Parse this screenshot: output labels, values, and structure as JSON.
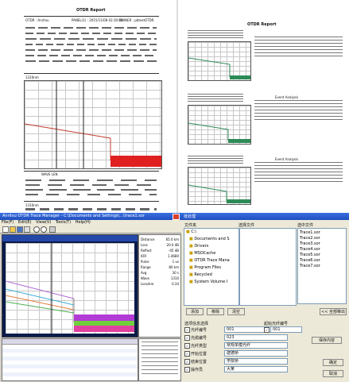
{
  "report": {
    "title": "OTDR Report",
    "q1_meta": [
      "OTDR : Anritsu",
      "PANEL(1) : 2015/11/08 02:30:00",
      "OWNER : pbtestOTDR"
    ],
    "q1_wave": "1310nm",
    "q1_table_title": "WAVE LEN",
    "q1_table2": "1310nm"
  },
  "q2": {
    "title": "OTDR Report",
    "blocks_title": "Event Analysis"
  },
  "otdr_window": {
    "title": "Anritsu OTDR Trace Manager - C:\\Documents and Settings\\...\\trace1.sor",
    "menu": [
      "File(F)",
      "Edit(E)",
      "View(V)",
      "Tools(T)",
      "Help(H)"
    ],
    "panel_items": [
      "Distance",
      "Loss",
      "Reflect",
      "IOR",
      "Pulse",
      "Range",
      "Avg",
      "Wave",
      "Loss/km"
    ],
    "panel_values": [
      "65.0 km",
      "20.0 dB",
      "-45 dB",
      "1.4680",
      "1 us",
      "80 km",
      "30 s",
      "1310",
      "0.34"
    ]
  },
  "dialog": {
    "title": "批处理",
    "col_left": "文件夹",
    "col_mid": "选择文件",
    "col_right": "选中文件",
    "tree": [
      "C:\\",
      "Documents and S",
      "Drivers",
      "MSOCache",
      "OTDR Trace Mana",
      "Program Files",
      "Recycled",
      "System Volume I"
    ],
    "selected_files": [
      "Trace1.sor",
      "Trace2.sor",
      "Trace3.sor",
      "Trace4.sor",
      "Trace5.sor",
      "Trace6.sor",
      "Trace7.sor"
    ],
    "btn_add": "添加",
    "btn_remove": "移除",
    "btn_clear": "清空",
    "btn_all_remove": "<< 全部移出",
    "group_label": "选项信息选择",
    "options": [
      "光纤编号",
      "光缆编号",
      "光纤类型",
      "开始位置",
      "结束位置",
      "操作员"
    ],
    "option_values": [
      "001",
      "023",
      "常规单模光纤",
      "建德桥",
      "学院桥",
      "大某"
    ],
    "start_label": "起始光纤编号",
    "start_value": "001",
    "btn_save": "保存内容",
    "btn_ok": "确定",
    "btn_cancel": "取消"
  },
  "colors": {
    "trace_red": "#c0392b",
    "noise_red": "#e02020",
    "trace_green": "#2e8b57",
    "win_blue": "#245edb"
  }
}
